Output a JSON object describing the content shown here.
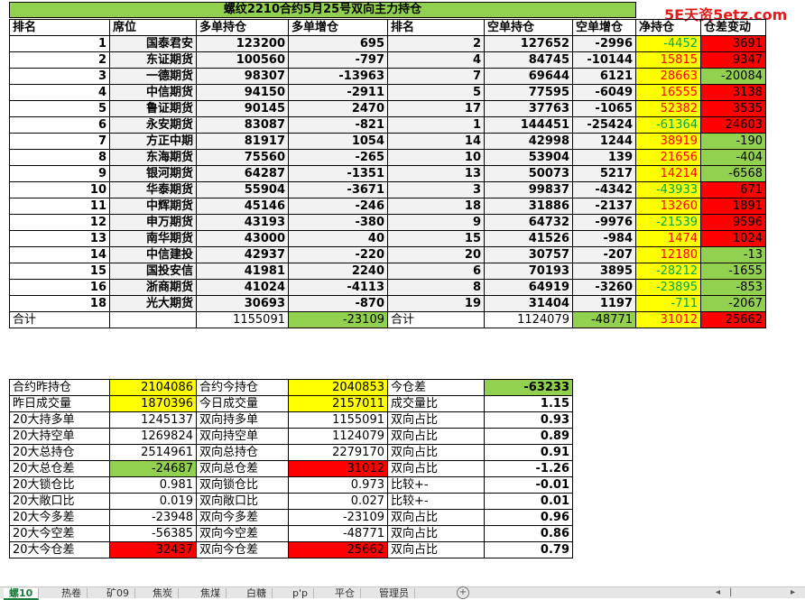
{
  "title": "螺纹2210合约5月25号双向主力持仓",
  "watermark": "5E天资5etz.com",
  "headers": [
    "排名",
    "席位",
    "多单持仓",
    "多单增仓",
    "排名",
    "空单持仓",
    "空单增仓",
    "净持仓",
    "仓差变动"
  ],
  "rows": [
    {
      "rank": "1",
      "seat": "国泰君安",
      "long": "123200",
      "long_chg": "695",
      "rank2": "2",
      "short": "127652",
      "short_chg": "-2996",
      "net": "-4452",
      "diff": "3691"
    },
    {
      "rank": "2",
      "seat": "东证期货",
      "long": "100560",
      "long_chg": "-797",
      "rank2": "4",
      "short": "84745",
      "short_chg": "-10144",
      "net": "15815",
      "diff": "9347"
    },
    {
      "rank": "3",
      "seat": "一德期货",
      "long": "98307",
      "long_chg": "-13963",
      "rank2": "7",
      "short": "69644",
      "short_chg": "6121",
      "net": "28663",
      "diff": "-20084"
    },
    {
      "rank": "4",
      "seat": "中信期货",
      "long": "94150",
      "long_chg": "-2911",
      "rank2": "5",
      "short": "77595",
      "short_chg": "-6049",
      "net": "16555",
      "diff": "3138"
    },
    {
      "rank": "5",
      "seat": "鲁证期货",
      "long": "90145",
      "long_chg": "2470",
      "rank2": "17",
      "short": "37763",
      "short_chg": "-1065",
      "net": "52382",
      "diff": "3535"
    },
    {
      "rank": "6",
      "seat": "永安期货",
      "long": "83087",
      "long_chg": "-821",
      "rank2": "1",
      "short": "144451",
      "short_chg": "-25424",
      "net": "-61364",
      "diff": "24603"
    },
    {
      "rank": "7",
      "seat": "方正中期",
      "long": "81917",
      "long_chg": "1054",
      "rank2": "14",
      "short": "42998",
      "short_chg": "1244",
      "net": "38919",
      "diff": "-190"
    },
    {
      "rank": "8",
      "seat": "东海期货",
      "long": "75560",
      "long_chg": "-265",
      "rank2": "10",
      "short": "53904",
      "short_chg": "139",
      "net": "21656",
      "diff": "-404"
    },
    {
      "rank": "9",
      "seat": "银河期货",
      "long": "64287",
      "long_chg": "-1351",
      "rank2": "13",
      "short": "50073",
      "short_chg": "5217",
      "net": "14214",
      "diff": "-6568"
    },
    {
      "rank": "10",
      "seat": "华泰期货",
      "long": "55904",
      "long_chg": "-3671",
      "rank2": "3",
      "short": "99837",
      "short_chg": "-4342",
      "net": "-43933",
      "diff": "671"
    },
    {
      "rank": "11",
      "seat": "中辉期货",
      "long": "45146",
      "long_chg": "-246",
      "rank2": "18",
      "short": "31886",
      "short_chg": "-2137",
      "net": "13260",
      "diff": "1891"
    },
    {
      "rank": "12",
      "seat": "申万期货",
      "long": "43193",
      "long_chg": "-380",
      "rank2": "9",
      "short": "64732",
      "short_chg": "-9976",
      "net": "-21539",
      "diff": "9596"
    },
    {
      "rank": "13",
      "seat": "南华期货",
      "long": "43000",
      "long_chg": "40",
      "rank2": "15",
      "short": "41526",
      "short_chg": "-984",
      "net": "1474",
      "diff": "1024"
    },
    {
      "rank": "14",
      "seat": "中信建投",
      "long": "42937",
      "long_chg": "-220",
      "rank2": "20",
      "short": "30757",
      "short_chg": "-207",
      "net": "12180",
      "diff": "-13"
    },
    {
      "rank": "15",
      "seat": "国投安信",
      "long": "41981",
      "long_chg": "2240",
      "rank2": "6",
      "short": "70193",
      "short_chg": "3895",
      "net": "-28212",
      "diff": "-1655"
    },
    {
      "rank": "16",
      "seat": "浙商期货",
      "long": "41024",
      "long_chg": "-4113",
      "rank2": "8",
      "short": "64919",
      "short_chg": "-3260",
      "net": "-23895",
      "diff": "-853"
    },
    {
      "rank": "18",
      "seat": "光大期货",
      "long": "30693",
      "long_chg": "-870",
      "rank2": "19",
      "short": "31404",
      "short_chg": "1197",
      "net": "-711",
      "diff": "-2067"
    }
  ],
  "total": {
    "label": "合计",
    "long": "1155091",
    "long_chg": "-23109",
    "label2": "合计",
    "short": "1124079",
    "short_chg": "-48771",
    "net": "31012",
    "diff": "25662"
  },
  "summary": [
    {
      "l1": "合约昨持仓",
      "v1": "2104086",
      "l2": "合约今持仓",
      "v2": "2040853",
      "l3": "今仓差",
      "v3": "-63233"
    },
    {
      "l1": "昨日成交量",
      "v1": "1870396",
      "l2": "今日成交量",
      "v2": "2157011",
      "l3": "成交量比",
      "v3": "1.15"
    },
    {
      "l1": "20大持多单",
      "v1": "1245137",
      "l2": "双向持多单",
      "v2": "1155091",
      "l3": "双向占比",
      "v3": "0.93"
    },
    {
      "l1": "20大持空单",
      "v1": "1269824",
      "l2": "双向持空单",
      "v2": "1124079",
      "l3": "双向占比",
      "v3": "0.89"
    },
    {
      "l1": "20大总持仓",
      "v1": "2514961",
      "l2": "双向总持仓",
      "v2": "2279170",
      "l3": "双向占比",
      "v3": "0.91"
    },
    {
      "l1": "20大总仓差",
      "v1": "-24687",
      "l2": "双向总仓差",
      "v2": "31012",
      "l3": "双向占比",
      "v3": "-1.26"
    },
    {
      "l1": "20大锁仓比",
      "v1": "0.981",
      "l2": "双向锁仓比",
      "v2": "0.973",
      "l3": "比较+-",
      "v3": "-0.01"
    },
    {
      "l1": "20大敞口比",
      "v1": "0.019",
      "l2": "双向敞口比",
      "v2": "0.027",
      "l3": "比较+-",
      "v3": "0.01"
    },
    {
      "l1": "20大今多差",
      "v1": "-23948",
      "l2": "双向今多差",
      "v2": "-23109",
      "l3": "双向占比",
      "v3": "0.96"
    },
    {
      "l1": "20大今空差",
      "v1": "-56385",
      "l2": "双向今空差",
      "v2": "-48771",
      "l3": "双向占比",
      "v3": "0.86"
    },
    {
      "l1": "20大今仓差",
      "v1": "32437",
      "l2": "双向今仓差",
      "v2": "25662",
      "l3": "双向占比",
      "v3": "0.79"
    }
  ],
  "tabs": [
    "螺10",
    "热卷",
    "矿09",
    "焦炭",
    "焦煤",
    "白糖",
    "p'p",
    "平仓",
    "管理员"
  ],
  "colors": {
    "yellow": "#ffff00",
    "green": "#92d050",
    "red": "#ff0000",
    "header_green": "#92d050"
  }
}
